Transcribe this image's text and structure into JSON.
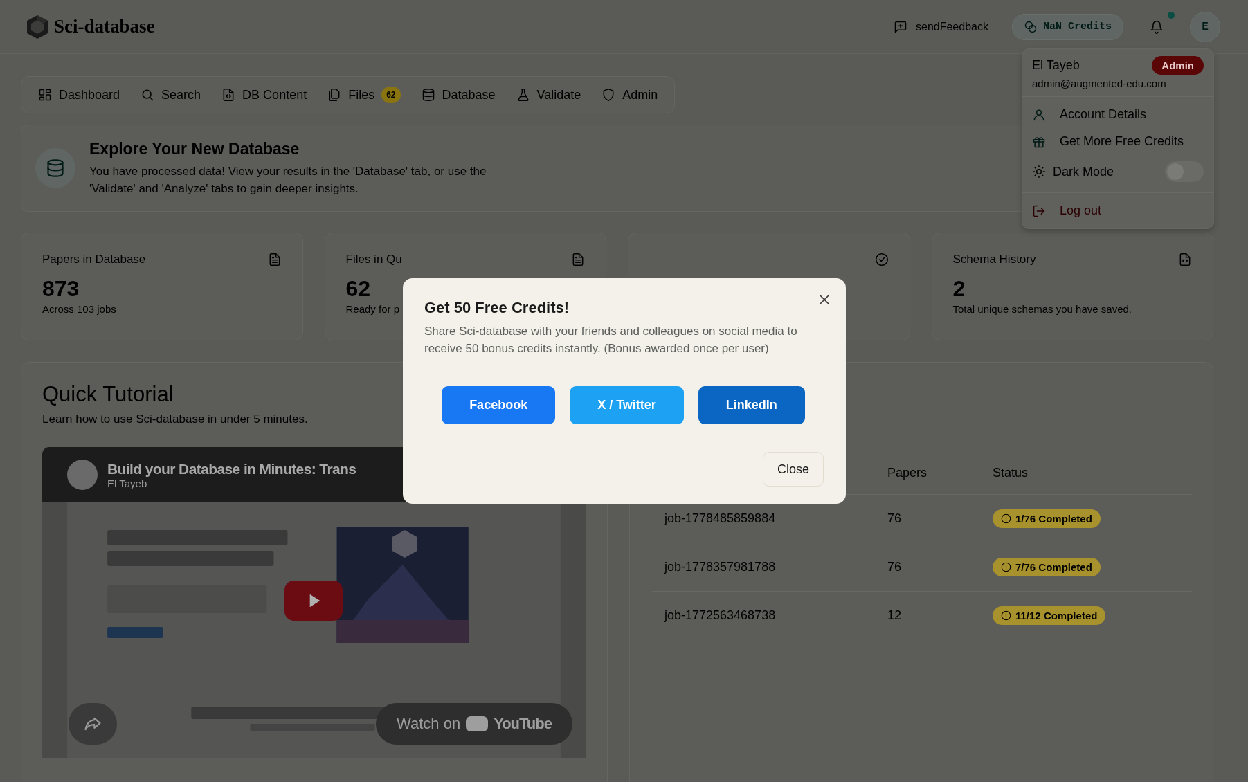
{
  "header": {
    "brand": "Sci-database",
    "feedback": "sendFeedback",
    "credits": "NaN Credits",
    "notification_dot": true,
    "avatar": "E"
  },
  "nav": [
    {
      "label": "Dashboard"
    },
    {
      "label": "Search"
    },
    {
      "label": "DB Content"
    },
    {
      "label": "Files",
      "badge": "62"
    },
    {
      "label": "Database"
    },
    {
      "label": "Validate"
    },
    {
      "label": "Admin"
    }
  ],
  "user_menu": {
    "name": "El Tayeb",
    "role": "Admin",
    "email": "admin@augmented-edu.com",
    "items": [
      {
        "kind": "link",
        "label": "Account Details"
      },
      {
        "kind": "link",
        "label": "Get More Free Credits"
      },
      {
        "kind": "toggle",
        "label": "Dark Mode",
        "on": false
      },
      {
        "kind": "danger",
        "label": "Log out"
      }
    ]
  },
  "banner": {
    "title": "Explore Your New Database",
    "text": "You have processed data! View your results in the 'Database' tab, or use the 'Validate' and 'Analyze' tabs to gain deeper insights."
  },
  "stats": [
    {
      "kind": "stat",
      "title": "Papers in Database",
      "value": "873",
      "note": "Across 103 jobs"
    },
    {
      "kind": "stat",
      "title": "Files in Qu",
      "value": "62",
      "note": "Ready for p"
    },
    {
      "kind": "covered"
    },
    {
      "kind": "stat",
      "title": "Schema History",
      "value": "2",
      "note": "Total unique schemas you have saved."
    }
  ],
  "tutorial": {
    "title": "Quick Tutorial",
    "subtitle": "Learn how to use Sci-database in under 5 minutes.",
    "video": {
      "kind": "picture",
      "title": "Build your Database in Minutes: Trans",
      "channel": "El Tayeb",
      "watch_on": "Watch on",
      "platform": "YouTube"
    }
  },
  "jobs": {
    "columns": [
      "Papers",
      "Status"
    ],
    "rows": [
      {
        "job": "job-1778485859884",
        "papers": "76",
        "status": "1/76 Completed",
        "color": "#a8922e"
      },
      {
        "job": "job-1778357981788",
        "papers": "76",
        "status": "7/76 Completed",
        "color": "#a8922e"
      },
      {
        "job": "job-1772563468738",
        "papers": "12",
        "status": "11/12 Completed",
        "color": "#a8922e"
      }
    ]
  },
  "modal": {
    "title": "Get 50 Free Credits!",
    "text": "Share Sci-database with your friends and colleagues on social media to receive 50 bonus credits instantly. (Bonus awarded once per user)",
    "share_buttons": [
      {
        "label": "Facebook",
        "color": "#1877f2"
      },
      {
        "label": "X / Twitter",
        "color": "#1da1f2"
      },
      {
        "label": "LinkedIn",
        "color": "#0a66c2"
      }
    ],
    "close": "Close"
  }
}
